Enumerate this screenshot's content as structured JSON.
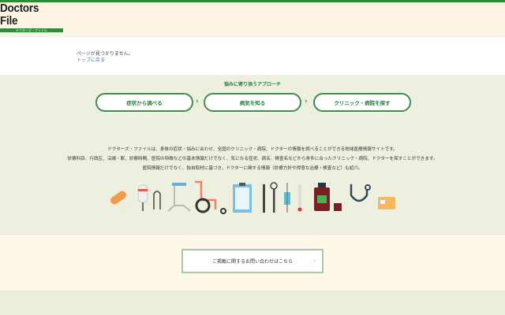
{
  "header": {
    "logo_text": "Doctors File",
    "logo_sub": "ドクターズ・ファイル"
  },
  "notice": {
    "message": "ページが見つかりません。",
    "top_link": "トップに戻る"
  },
  "approach": {
    "title": "悩みに寄り添うアプローチ",
    "buttons": [
      {
        "label": "症状から調べる"
      },
      {
        "label": "病気を知る"
      },
      {
        "label": "クリニック・病院を探す"
      }
    ]
  },
  "description": [
    "ドクターズ・ファイルは、身体の症状・悩みに合わせ、全国のクリニック・病院、ドクターの情報を調べることができる地域医療情報サイトです。",
    "診療科目、行政区、沿線・駅、診療時間、医院の特徴などの基本情報だけでなく、気になる症状、病名、検査名などから条件に合ったクリニック・病院、ドクターを探すことができます。",
    "医院情報だけでなく、独自取材に基づき、ドクターに関する情報（診療方針や得意な治療・検査など）も紹介。"
  ],
  "contact": {
    "label": "ご掲載に関するお問い合わせはこちら"
  },
  "colors": {
    "brand_green": "#2e8b3a",
    "cream": "#fdf4e4",
    "sage": "#eef0df"
  }
}
